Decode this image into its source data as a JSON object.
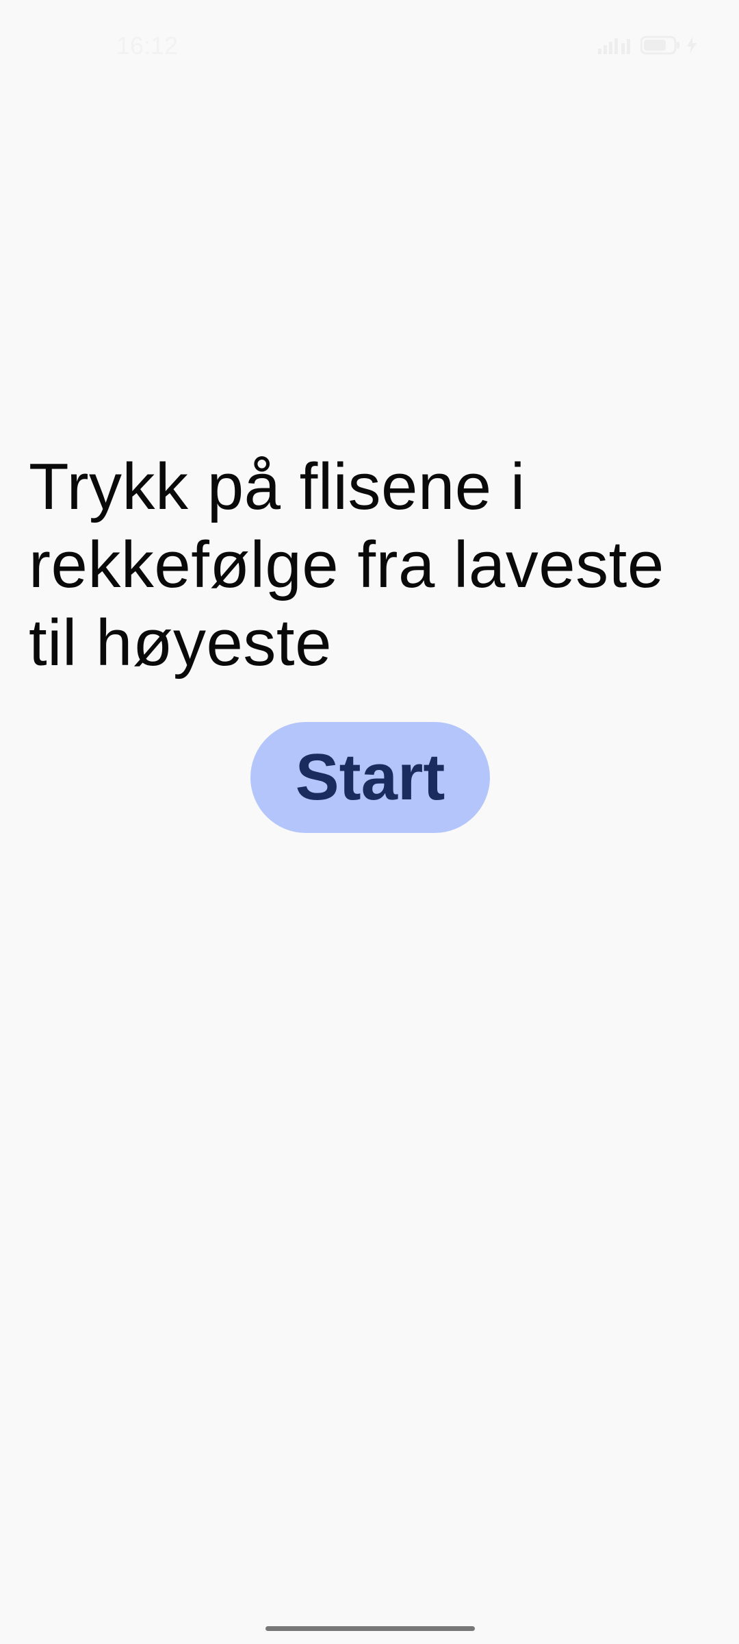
{
  "status_bar": {
    "time": "16:12"
  },
  "main": {
    "instruction": "Trykk på flisene i rekkefølge fra laveste til høyeste",
    "start_label": "Start"
  },
  "colors": {
    "background": "#f9f9f9",
    "button_bg": "#b3c5fb",
    "button_text": "#1a2b5e"
  }
}
